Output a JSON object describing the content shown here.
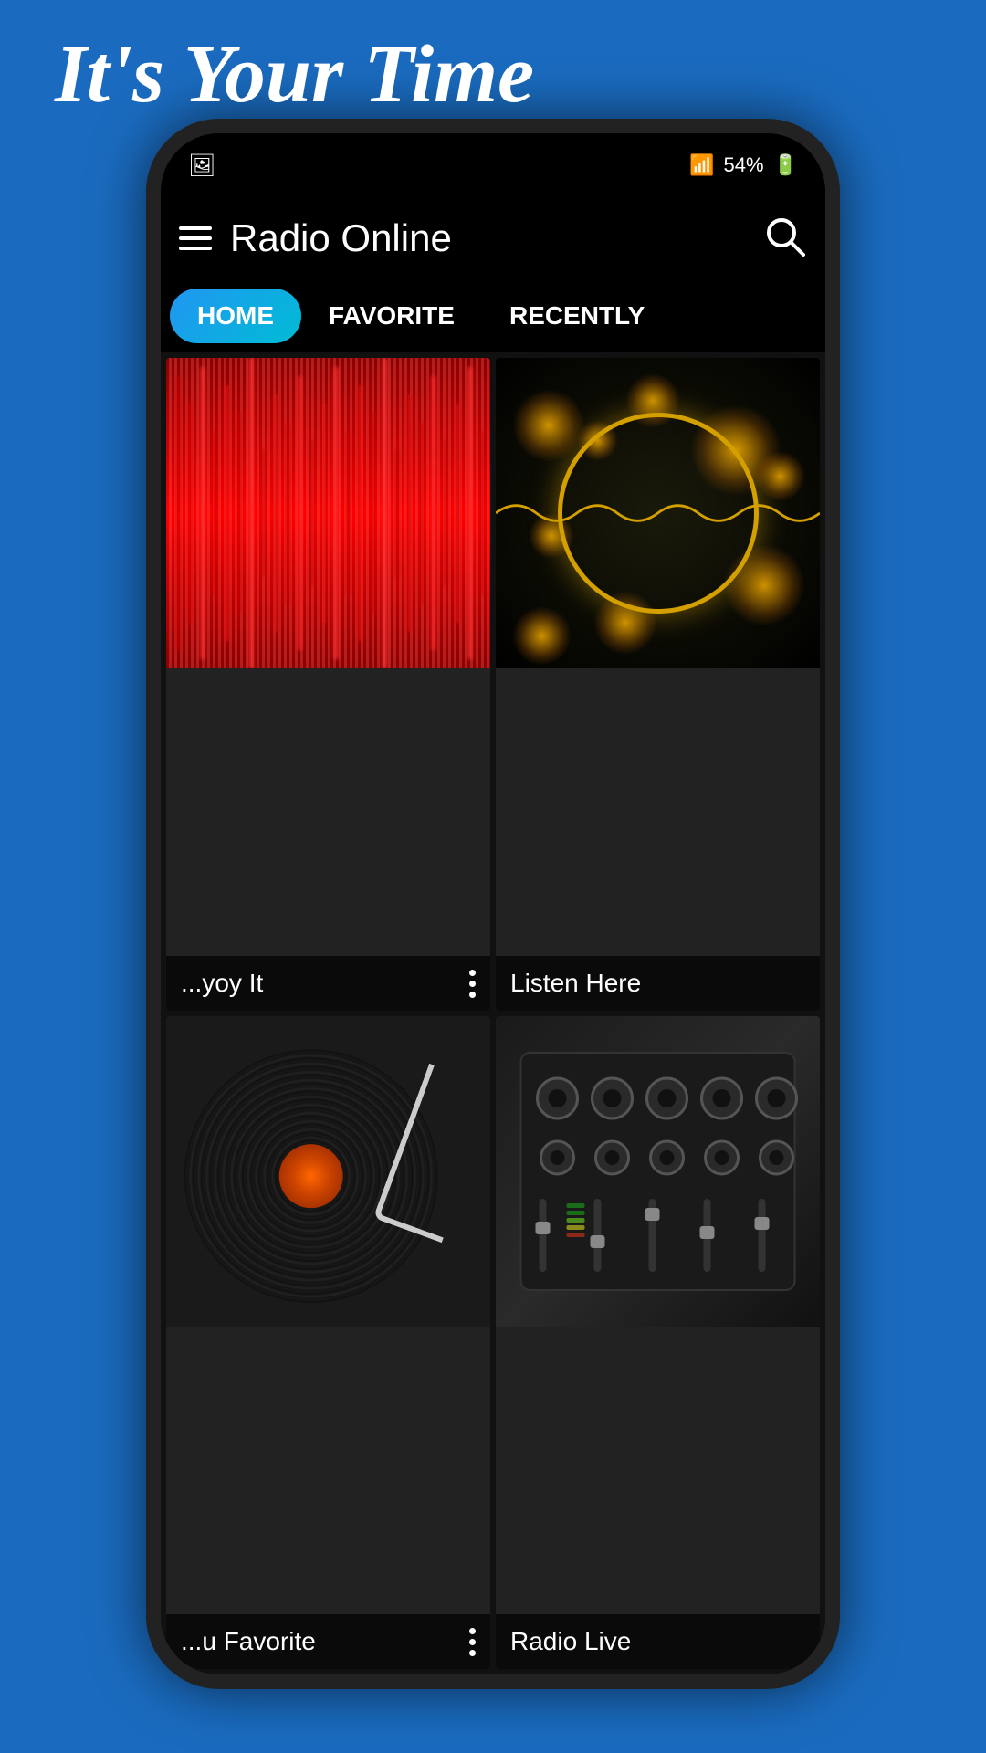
{
  "page": {
    "headline": "It's Your Time",
    "background_color": "#1a6bbf"
  },
  "status_bar": {
    "battery": "54%",
    "signal": "●●●"
  },
  "app": {
    "title": "Radio Online",
    "tabs": [
      {
        "id": "home",
        "label": "HOME",
        "active": true
      },
      {
        "id": "favorite",
        "label": "FAVORITE",
        "active": false
      },
      {
        "id": "recently",
        "label": "RECENTLY",
        "active": false
      }
    ],
    "grid_items": [
      {
        "id": "item1",
        "label": "...yoy It",
        "type": "red-wave",
        "has_dots": true
      },
      {
        "id": "item2",
        "label": "Listen Here",
        "type": "gold-bokeh",
        "has_dots": false
      },
      {
        "id": "item3",
        "label": "...u Favorite",
        "type": "vinyl",
        "has_dots": true
      },
      {
        "id": "item4",
        "label": "Radio Live",
        "type": "mixer",
        "has_dots": false
      }
    ]
  },
  "icons": {
    "hamburger": "☰",
    "search": "🔍",
    "more": "⋮"
  }
}
